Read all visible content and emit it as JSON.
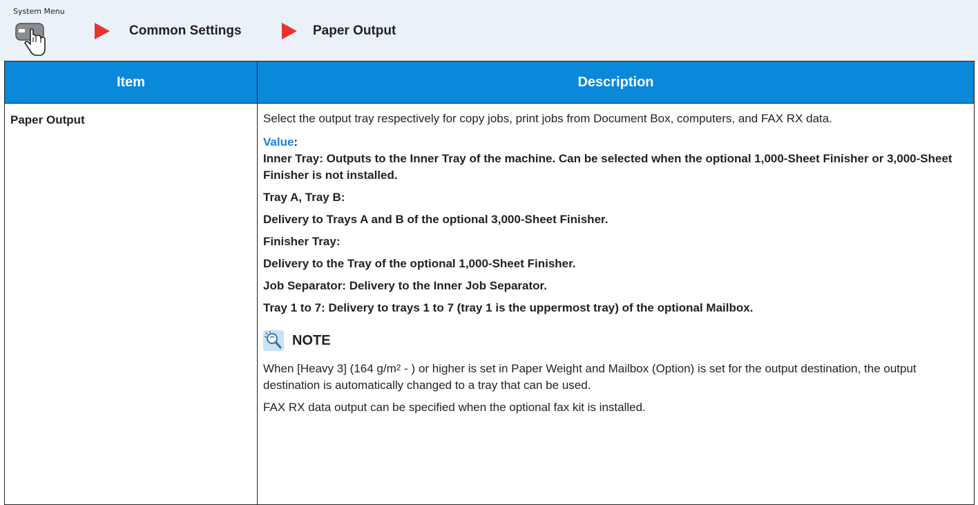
{
  "breadcrumb": {
    "system_menu_label": "System Menu",
    "system_menu_icon": "hand-pressing-button-icon",
    "crumbs": [
      "Common Settings",
      "Paper Output"
    ],
    "arrow_color": "#e8322e"
  },
  "table": {
    "header_color": "#0a88d9",
    "headers": {
      "item": "Item",
      "description": "Description"
    },
    "rows": [
      {
        "item": "Paper Output",
        "description": "Select the output tray respectively for copy jobs, print jobs from Document Box, computers, and FAX RX data.",
        "value_label": "Value",
        "value_colon": ":",
        "values": [
          "Inner Tray: Outputs to the Inner Tray of the machine. Can be selected when the optional 1,000-Sheet Finisher or 3,000-Sheet Finisher is not installed.",
          "Tray A, Tray B:",
          "Delivery to Trays A and B of the optional 3,000-Sheet Finisher.",
          "Finisher Tray:",
          "Delivery to the Tray of the optional 1,000-Sheet Finisher.",
          "Job Separator: Delivery to the Inner Job Separator.",
          "Tray 1 to 7: Delivery to trays 1 to 7 (tray 1 is the uppermost tray) of the optional Mailbox."
        ],
        "note": {
          "title": "NOTE",
          "icon": "magnifier-note-icon",
          "text1_before": "When [Heavy 3] (164 g/m",
          "text1_sup": "2",
          "text1_after": " - ) or higher is set in Paper Weight and Mailbox (Option) is set for the output destination, the output destination is automatically changed to a tray that can be used.",
          "text2": "FAX RX data output can be specified when the optional fax kit is installed."
        }
      }
    ]
  }
}
